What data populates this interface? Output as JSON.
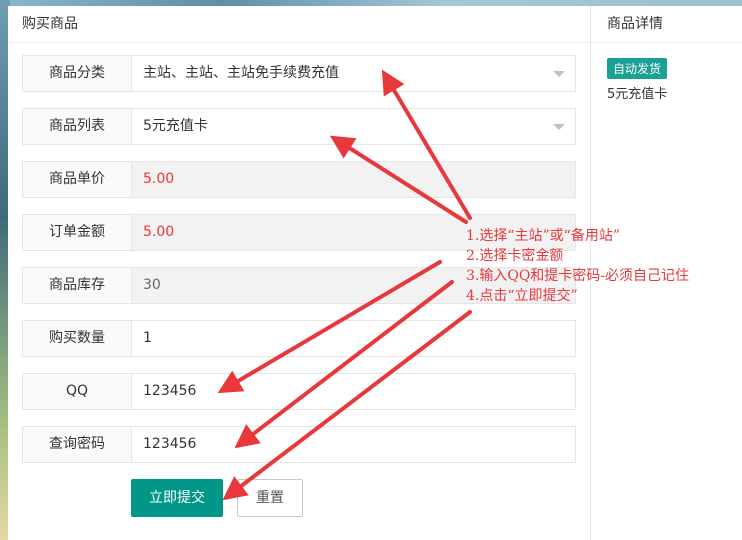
{
  "main": {
    "title": "购买商品"
  },
  "side": {
    "title": "商品详情",
    "tag": "自动发货",
    "product": "5元充值卡"
  },
  "form": {
    "category": {
      "label": "商品分类",
      "value": "主站、主站、主站免手续费充值"
    },
    "product_list": {
      "label": "商品列表",
      "value": "5元充值卡"
    },
    "unit_price": {
      "label": "商品单价",
      "value": "5.00"
    },
    "order_amount": {
      "label": "订单金额",
      "value": "5.00"
    },
    "stock": {
      "label": "商品库存",
      "value": "30"
    },
    "quantity": {
      "label": "购买数量",
      "value": "1"
    },
    "qq": {
      "label": "QQ",
      "value": "123456"
    },
    "query_password": {
      "label": "查询密码",
      "value": "123456"
    }
  },
  "buttons": {
    "submit": "立即提交",
    "reset": "重置"
  },
  "annotation": {
    "line1": "1.选择“主站”或“备用站”",
    "line2": "2.选择卡密金额",
    "line3": "3.输入QQ和提卡密码-必须自己记住",
    "line4": "4.点击“立即提交”"
  },
  "colors": {
    "accent": "#009688",
    "tag": "#1aa094",
    "price": "#ee3333",
    "annotation": "#e8383b"
  }
}
